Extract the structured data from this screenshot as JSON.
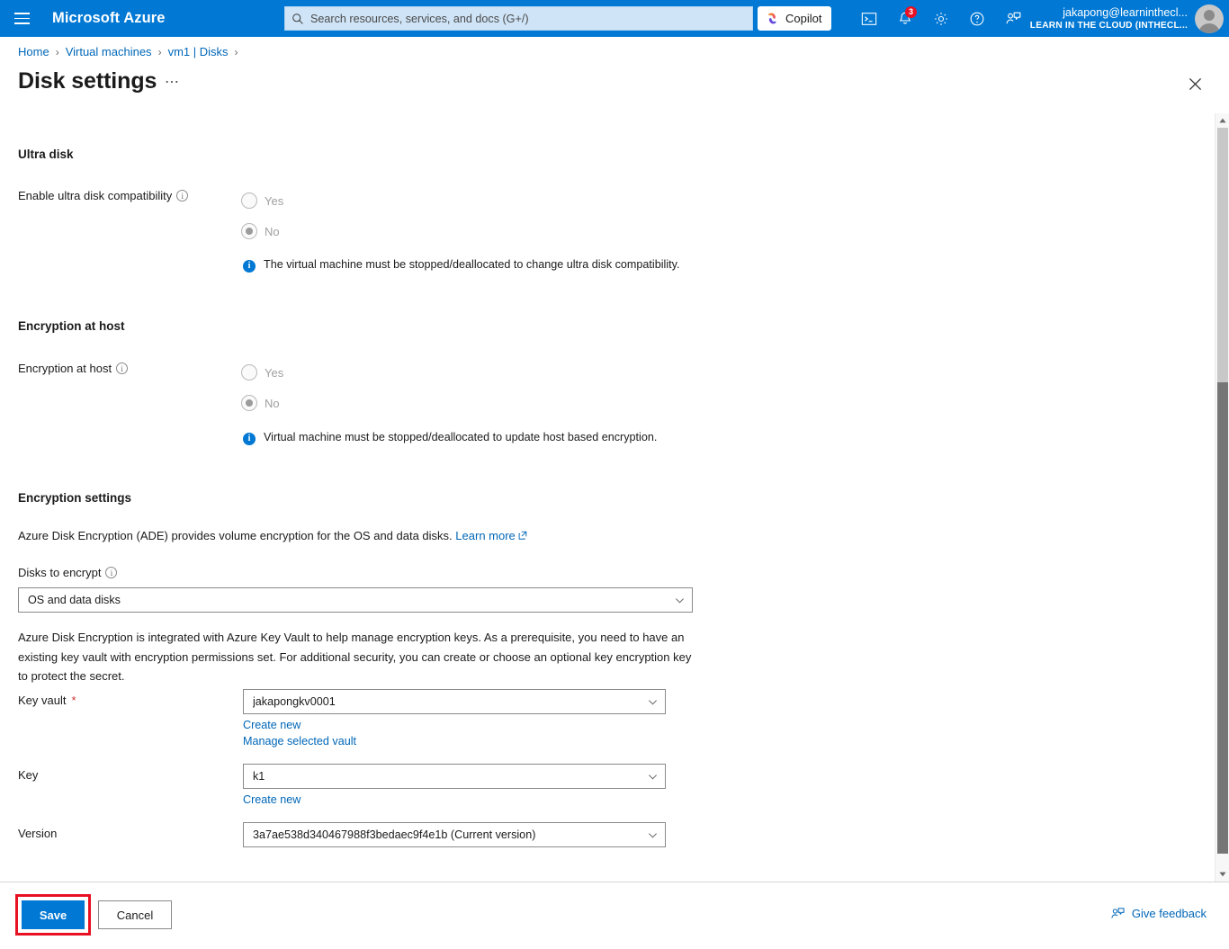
{
  "topbar": {
    "menu_icon": "hamburger-icon",
    "brand": "Microsoft Azure",
    "search": {
      "icon": "search-icon",
      "placeholder": "Search resources, services, and docs (G+/)",
      "value": ""
    },
    "copilot": {
      "label": "Copilot",
      "icon": "copilot-icon"
    },
    "icons": [
      {
        "name": "cloud-shell-icon",
        "glyph": "cloud-shell"
      },
      {
        "name": "notifications-icon",
        "glyph": "bell",
        "badge": "3"
      },
      {
        "name": "settings-icon",
        "glyph": "gear"
      },
      {
        "name": "help-icon",
        "glyph": "question"
      },
      {
        "name": "feedback-icon",
        "glyph": "person-feedback"
      }
    ],
    "account": {
      "user": "jakapong@learninthecl...",
      "org": "LEARN IN THE CLOUD (INTHECL...",
      "avatar": "avatar-icon"
    }
  },
  "breadcrumb": {
    "items": [
      "Home",
      "Virtual machines",
      "vm1 | Disks"
    ],
    "separator": "›"
  },
  "page": {
    "title": "Disk settings",
    "more_label": "⋯",
    "close_icon": "close-icon"
  },
  "ultra_disk": {
    "section_title": "Ultra disk",
    "field_label": "Enable ultra disk compatibility",
    "info_icon": "info-outline-icon",
    "options": [
      {
        "label": "Yes",
        "selected": false
      },
      {
        "label": "No",
        "selected": true
      }
    ],
    "note": "The virtual machine must be stopped/deallocated to change ultra disk compatibility.",
    "note_icon": "info-filled-icon"
  },
  "encryption_at_host": {
    "section_title": "Encryption at host",
    "field_label": "Encryption at host",
    "info_icon": "info-outline-icon",
    "options": [
      {
        "label": "Yes",
        "selected": false
      },
      {
        "label": "No",
        "selected": true
      }
    ],
    "note": "Virtual machine must be stopped/deallocated to update host based encryption.",
    "note_icon": "info-filled-icon"
  },
  "encryption_settings": {
    "section_title": "Encryption settings",
    "description": "Azure Disk Encryption (ADE) provides volume encryption for the OS and data disks.",
    "learn_more": "Learn more",
    "learn_more_icon": "external-link-icon",
    "disks_to_encrypt": {
      "label": "Disks to encrypt",
      "info_icon": "info-outline-icon",
      "value": "OS and data disks",
      "chevron": "chevron-down-icon"
    },
    "kv_paragraph": "Azure Disk Encryption is integrated with Azure Key Vault to help manage encryption keys. As a prerequisite, you need to have an existing key vault with encryption permissions set. For additional security, you can create or choose an optional key encryption key to protect the secret.",
    "key_vault": {
      "label": "Key vault",
      "required_mark": "*",
      "value": "jakapongkv0001",
      "chevron": "chevron-down-icon",
      "create_new": "Create new",
      "manage": "Manage selected vault"
    },
    "key": {
      "label": "Key",
      "value": "k1",
      "chevron": "chevron-down-icon",
      "create_new": "Create new"
    },
    "version": {
      "label": "Version",
      "value": "3a7ae538d340467988f3bedaec9f4e1b (Current version)",
      "chevron": "chevron-down-icon"
    }
  },
  "bottombar": {
    "save": "Save",
    "cancel": "Cancel",
    "give_feedback": "Give feedback",
    "feedback_icon": "person-feedback-icon",
    "highlight_color": "#e81123"
  },
  "scrollbar": {
    "up_icon": "scroll-up-icon",
    "down_icon": "scroll-down-icon"
  }
}
